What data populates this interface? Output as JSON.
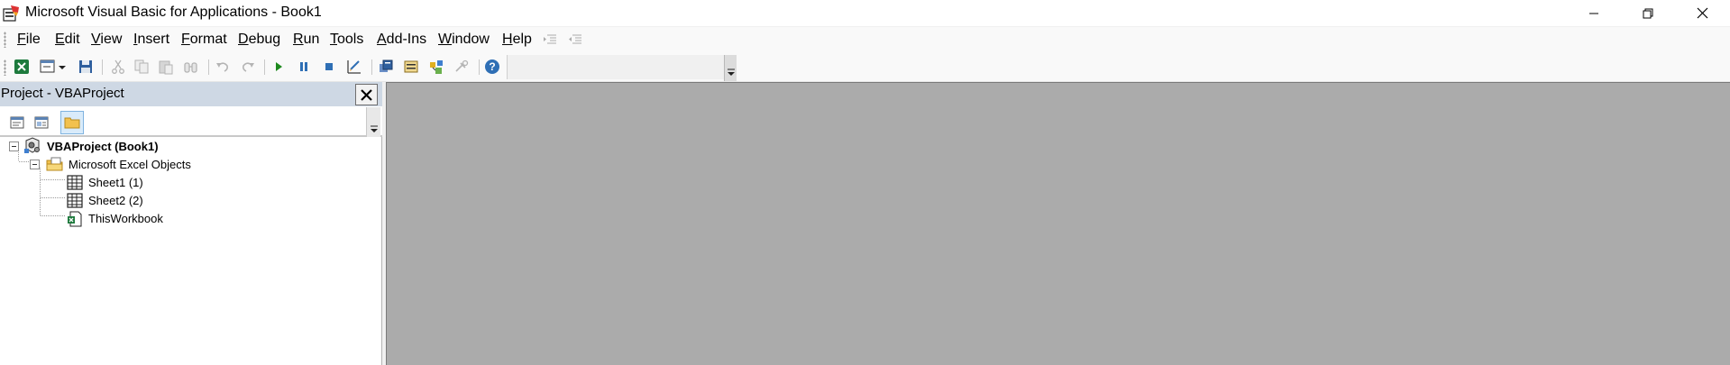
{
  "window": {
    "title": "Microsoft Visual Basic for Applications - Book1",
    "controls": {
      "minimize_icon": "minimize-icon",
      "restore_icon": "restore-icon",
      "close_icon": "close-icon"
    }
  },
  "menu": {
    "items": [
      {
        "accel": "F",
        "rest": "ile"
      },
      {
        "accel": "E",
        "rest": "dit"
      },
      {
        "accel": "V",
        "rest": "iew"
      },
      {
        "accel": "I",
        "rest": "nsert"
      },
      {
        "accel": "F",
        "rest": "ormat"
      },
      {
        "accel": "D",
        "rest": "ebug"
      },
      {
        "accel": "R",
        "rest": "un"
      },
      {
        "accel": "T",
        "rest": "ools"
      },
      {
        "accel": "A",
        "rest": "dd-Ins"
      },
      {
        "accel": "W",
        "rest": "indow"
      },
      {
        "accel": "H",
        "rest": "elp"
      }
    ]
  },
  "toolbar": {
    "buttons": [
      "view-excel-icon",
      "insert-userform-icon",
      "save-icon",
      "cut-icon",
      "copy-icon",
      "paste-icon",
      "find-icon",
      "undo-icon",
      "redo-icon",
      "run-icon",
      "break-icon",
      "reset-icon",
      "design-mode-icon",
      "project-explorer-icon",
      "properties-window-icon",
      "object-browser-icon",
      "toolbox-icon",
      "help-icon"
    ]
  },
  "project_panel": {
    "title": "Project - VBAProject",
    "buttons": [
      "view-code-icon",
      "view-object-icon",
      "toggle-folders-icon"
    ],
    "tree": {
      "root": "VBAProject (Book1)",
      "folder": "Microsoft Excel Objects",
      "items": [
        "Sheet1 (1)",
        "Sheet2 (2)",
        "ThisWorkbook"
      ]
    }
  },
  "colors": {
    "panel_header": "#ced8e4",
    "mdi_background": "#ababab",
    "run_green": "#1e8a1e",
    "accent_blue": "#2f6fb5"
  }
}
